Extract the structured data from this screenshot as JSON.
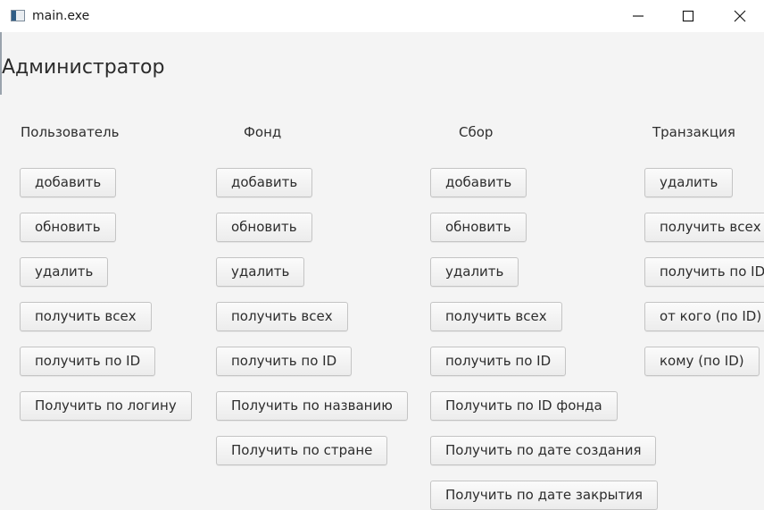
{
  "window": {
    "title": "main.exe",
    "icon": "app-window-icon",
    "controls": [
      "minimize-icon",
      "maximize-icon",
      "close-icon"
    ]
  },
  "page": {
    "title": "Администратор"
  },
  "columns": {
    "user": {
      "header": "Пользователь",
      "buttons": [
        "добавить",
        "обновить",
        "удалить",
        "получить всех",
        "получить по ID",
        "Получить по логину"
      ]
    },
    "fund": {
      "header": "Фонд",
      "buttons": [
        "добавить",
        "обновить",
        "удалить",
        "получить всех",
        "получить по ID",
        "Получить по названию",
        "Получить по стране"
      ]
    },
    "collection": {
      "header": "Сбор",
      "buttons": [
        "добавить",
        "обновить",
        "удалить",
        "получить всех",
        "получить по ID",
        "Получить по ID фонда",
        "Получить по дате создания",
        "Получить по дате закрытия"
      ]
    },
    "transaction": {
      "header": "Транзакция",
      "buttons": [
        "удалить",
        "получить всех",
        "получить по ID",
        "от кого (по ID)",
        "кому (по ID)"
      ]
    }
  }
}
